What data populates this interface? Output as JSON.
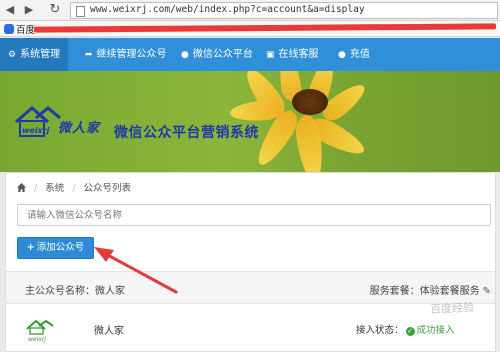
{
  "browser": {
    "url": "www.weixrj.com/web/index.php?c=account&a=display",
    "bookmark_label": "百度",
    "nav_icons": [
      "back-icon",
      "forward-icon",
      "reload-icon"
    ]
  },
  "topnav": {
    "items": [
      {
        "label": "系统管理",
        "icon": "gear-icon",
        "active": true
      },
      {
        "label": "继续管理公众号",
        "icon": "share-icon",
        "active": false
      },
      {
        "label": "微信公众平台",
        "icon": "chat-icon",
        "active": false
      },
      {
        "label": "在线客服",
        "icon": "briefcase-icon",
        "active": false
      },
      {
        "label": "充值",
        "icon": "chat-icon",
        "active": false
      }
    ]
  },
  "banner": {
    "logo_subtext": "weixrj",
    "logo_text": "微人家",
    "title": "微信公众平台营销系统"
  },
  "breadcrumb": {
    "items": [
      "系统",
      "公众号列表"
    ]
  },
  "search": {
    "placeholder": "请输入微信公众号名称"
  },
  "add_button": {
    "label": "添加公众号"
  },
  "section": {
    "main_account_label": "主公众号名称：微人家",
    "package_label": "服务套餐：体验套餐服务"
  },
  "account": {
    "logo_text": "weixrj",
    "name": "微人家",
    "status_label": "接入状态：",
    "status_value": "成功接入"
  },
  "watermark": "百度经验",
  "colors": {
    "nav_blue": "#2f8fd8",
    "nav_active": "#2479bd",
    "button_blue": "#2d8ad6",
    "annotation_red": "#e23b3b",
    "success_green": "#3aa33a",
    "banner_text": "#1e3aa8"
  }
}
